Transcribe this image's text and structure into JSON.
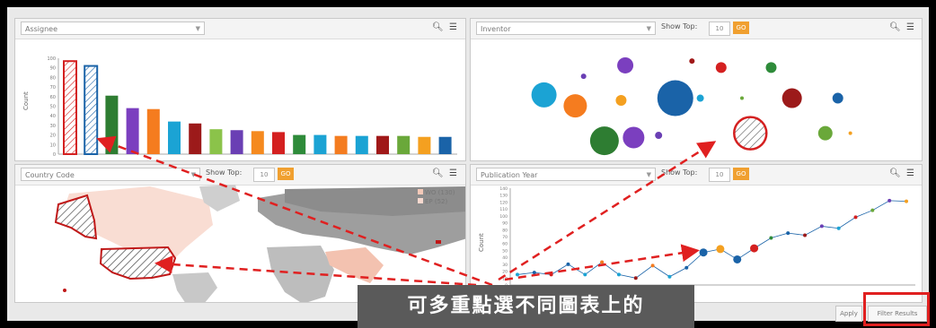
{
  "assignee_panel": {
    "field_label": "Assignee",
    "ylabel": "Count",
    "y_ticks": [
      "100",
      "90",
      "80",
      "70",
      "60",
      "50",
      "40",
      "30",
      "20",
      "10",
      "0"
    ]
  },
  "inventor_panel": {
    "field_label": "Inventor",
    "show_top_label": "Show Top:",
    "top_value": "10",
    "top_button": "GO"
  },
  "country_panel": {
    "field_label": "Country Code",
    "show_top_label": "Show Top:",
    "top_value": "10",
    "top_button": "GO",
    "legend": [
      {
        "label": "WO (130)",
        "color": "#f4c9b8"
      },
      {
        "label": "EP (52)",
        "color": "#f7d9cf"
      }
    ]
  },
  "pubyear_panel": {
    "field_label": "Publication Year",
    "show_top_label": "Show Top:",
    "top_value": "10",
    "top_button": "GO",
    "ylabel": "Count",
    "y_ticks": [
      "140",
      "130",
      "120",
      "110",
      "100",
      "90",
      "80",
      "70",
      "60",
      "50",
      "40",
      "30",
      "20",
      "10",
      "0"
    ]
  },
  "caption": "可多重點選不同圖表上的",
  "buttons": {
    "apply": "Apply",
    "filter_results": "Filter Results"
  },
  "colors": {
    "highlight_red": "#e02020",
    "accent_orange": "#f0a030"
  },
  "chart_data": [
    {
      "type": "bar",
      "ylabel": "Count",
      "ylim": [
        0,
        100
      ],
      "values": [
        97,
        92,
        61,
        48,
        47,
        34,
        32,
        26,
        25,
        24,
        23,
        20,
        20,
        19,
        19,
        19,
        19,
        18,
        18
      ],
      "colors": [
        "#ffffff",
        "#ffffff",
        "#2e7d32",
        "#7b3fbf",
        "#f57c1f",
        "#1ba3d4",
        "#9c1a1a",
        "#8bc34a",
        "#6a3fb4",
        "#f58a1f",
        "#d42020",
        "#2e8b3a",
        "#1ba3d4",
        "#f47c20",
        "#1ba3d4",
        "#a01818",
        "#6aa83a",
        "#f4a020",
        "#1a63a8"
      ],
      "highlighted": [
        0,
        1
      ]
    },
    {
      "type": "scatter",
      "series": [
        {
          "color": "#1ba3d4",
          "x": 2.5,
          "y": 55,
          "size": 14
        },
        {
          "color": "#6a3fb4",
          "x": 12,
          "y": 72,
          "size": 3
        },
        {
          "color": "#f57c1f",
          "x": 10,
          "y": 45,
          "size": 13
        },
        {
          "color": "#7b3fbf",
          "x": 22,
          "y": 82,
          "size": 9
        },
        {
          "color": "#f4a020",
          "x": 21,
          "y": 50,
          "size": 6
        },
        {
          "color": "#1a63a8",
          "x": 34,
          "y": 52,
          "size": 20
        },
        {
          "color": "#a01818",
          "x": 38,
          "y": 86,
          "size": 3
        },
        {
          "color": "#d42020",
          "x": 45,
          "y": 80,
          "size": 6
        },
        {
          "color": "#1ba3d4",
          "x": 40,
          "y": 52,
          "size": 4
        },
        {
          "color": "#2e8b3a",
          "x": 57,
          "y": 80,
          "size": 6
        },
        {
          "color": "#6aa83a",
          "x": 50,
          "y": 52,
          "size": 2
        },
        {
          "color": "#9c1a1a",
          "x": 62,
          "y": 52,
          "size": 11
        },
        {
          "color": "#1a63a8",
          "x": 73,
          "y": 52,
          "size": 6
        },
        {
          "color": "#2e7d32",
          "x": 17,
          "y": 13,
          "size": 16
        },
        {
          "color": "#7b3fbf",
          "x": 24,
          "y": 16,
          "size": 12
        },
        {
          "color": "#6a3fb4",
          "x": 30,
          "y": 18,
          "size": 4
        },
        {
          "color": "#ffffff",
          "x": 52,
          "y": 20,
          "size": 18
        },
        {
          "color": "#6aa83a",
          "x": 70,
          "y": 20,
          "size": 8
        },
        {
          "color": "#f4a020",
          "x": 76,
          "y": 20,
          "size": 2
        }
      ],
      "highlighted": [
        16
      ]
    },
    {
      "type": "line",
      "ylabel": "Count",
      "ylim": [
        0,
        140
      ],
      "values": [
        15,
        18,
        15,
        30,
        15,
        33,
        15,
        10,
        28,
        12,
        25,
        47,
        52,
        37,
        53,
        68,
        75,
        72,
        85,
        82,
        98,
        108,
        122,
        121
      ],
      "point_colors": [
        "#1ba3d4",
        "#1a63a8",
        "#d42020",
        "#1a63a8",
        "#1ba3d4",
        "#f47c20",
        "#1ba3d4",
        "#9c1a1a",
        "#f47c20",
        "#1ba3d4",
        "#1a63a8",
        "#1a63a8",
        "#f4a020",
        "#1a63a8",
        "#d42020",
        "#2e8b3a",
        "#1a63a8",
        "#9c1a1a",
        "#6a3fb4",
        "#1ba3d4",
        "#d42020",
        "#6aa83a",
        "#6a3fb4",
        "#f4a020"
      ]
    }
  ]
}
